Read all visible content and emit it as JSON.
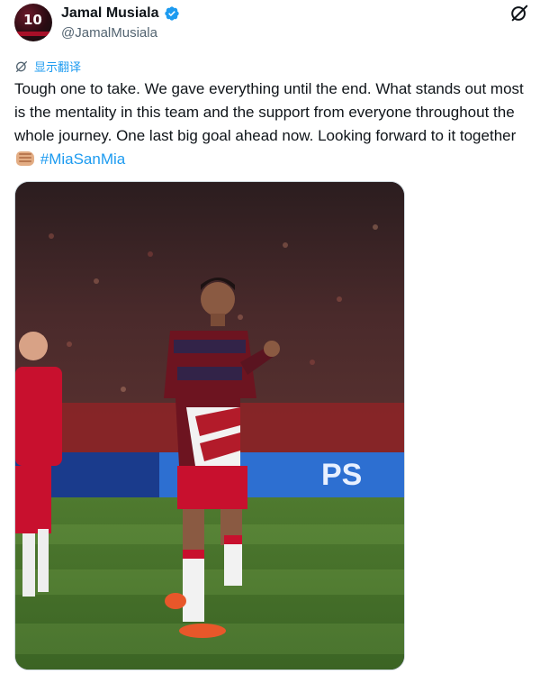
{
  "author": {
    "display_name": "Jamal Musiala",
    "handle": "@JamalMusiala",
    "avatar_number": "10"
  },
  "translate_label": "显示翻译",
  "tweet": {
    "text": "Tough one to take. We gave everything until the end. What stands out most is the mentality in this team and the support from everyone throughout the whole journey. One last big goal ahead now. Looking forward to it together",
    "emoji": "fist-emoji",
    "hashtag": "#MiaSanMia"
  },
  "media": {
    "ad_board_text": "PS"
  },
  "colors": {
    "accent": "#1d9bf0",
    "text": "#0f1419",
    "secondary_text": "#536471",
    "bayern_red": "#c8102e"
  },
  "icons": {
    "verified": "verified-badge-icon",
    "grok": "grok-icon",
    "translate": "translate-icon"
  }
}
